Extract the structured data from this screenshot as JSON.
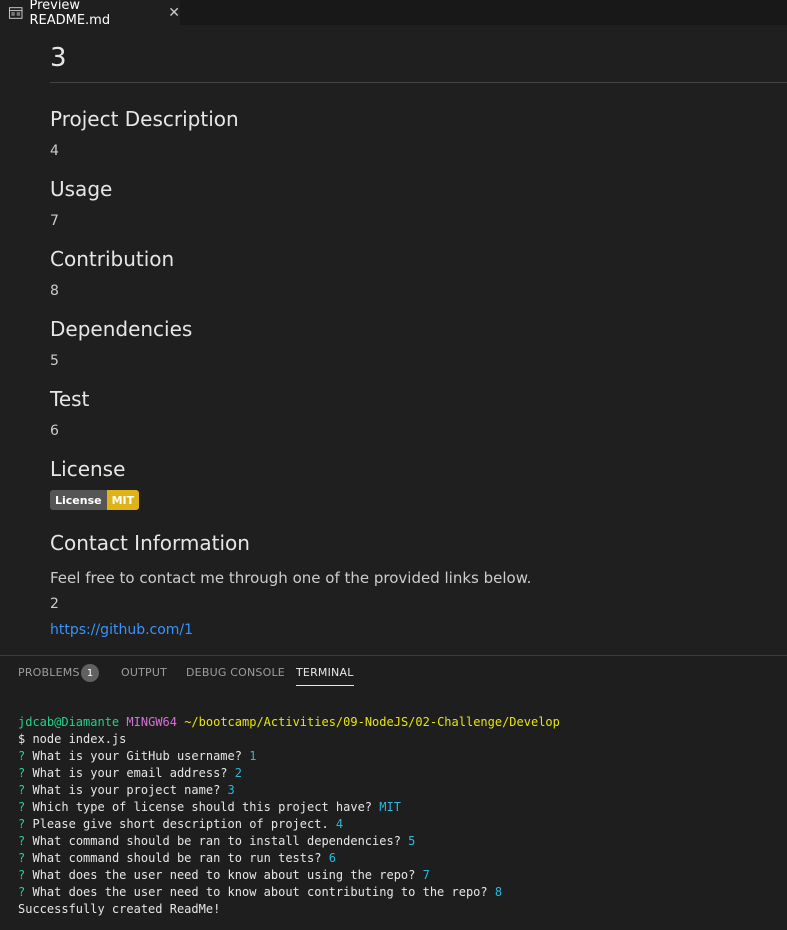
{
  "tab": {
    "title": "Preview README.md",
    "close": "✕"
  },
  "preview": {
    "heading": "3",
    "sections": [
      {
        "title": "Project Description",
        "body": "4"
      },
      {
        "title": "Usage",
        "body": "7"
      },
      {
        "title": "Contribution",
        "body": "8"
      },
      {
        "title": "Dependencies",
        "body": "5"
      },
      {
        "title": "Test",
        "body": "6"
      },
      {
        "title": "License"
      },
      {
        "title": "Contact Information"
      }
    ],
    "badge": {
      "label": "License",
      "value": "MIT"
    },
    "contact": {
      "text": "Feel free to contact me through one of the provided links below.",
      "value": "2",
      "link": "https://github.com/1"
    }
  },
  "panel": {
    "tabs": [
      "PROBLEMS",
      "OUTPUT",
      "DEBUG CONSOLE",
      "TERMINAL"
    ],
    "problems_count": "1"
  },
  "terminal": {
    "user": "jdcab@Diamante",
    "env": "MINGW64",
    "path": "~/bootcamp/Activities/09-NodeJS/02-Challenge/Develop",
    "command": "$ node index.js",
    "qmark": "?",
    "qa": [
      {
        "q": "What is your GitHub username?",
        "a": "1"
      },
      {
        "q": "What is your email address?",
        "a": "2"
      },
      {
        "q": "What is your project name?",
        "a": "3"
      },
      {
        "q": "Which type of license should this project have?",
        "a": "MIT"
      },
      {
        "q": "Please give short description of project.",
        "a": "4"
      },
      {
        "q": "What command should be ran to install dependencies?",
        "a": "5"
      },
      {
        "q": "What command should be ran to run tests?",
        "a": "6"
      },
      {
        "q": "What does the user need to know about using the repo?",
        "a": "7"
      },
      {
        "q": "What does the user need to know about contributing to the repo?",
        "a": "8"
      }
    ],
    "result": "Successfully created ReadMe!"
  },
  "colors": {
    "accent_link": "#3794ff",
    "badge_value": "#dfb317",
    "prompt_green": "#23d18b",
    "answer_cyan": "#29b8db"
  }
}
